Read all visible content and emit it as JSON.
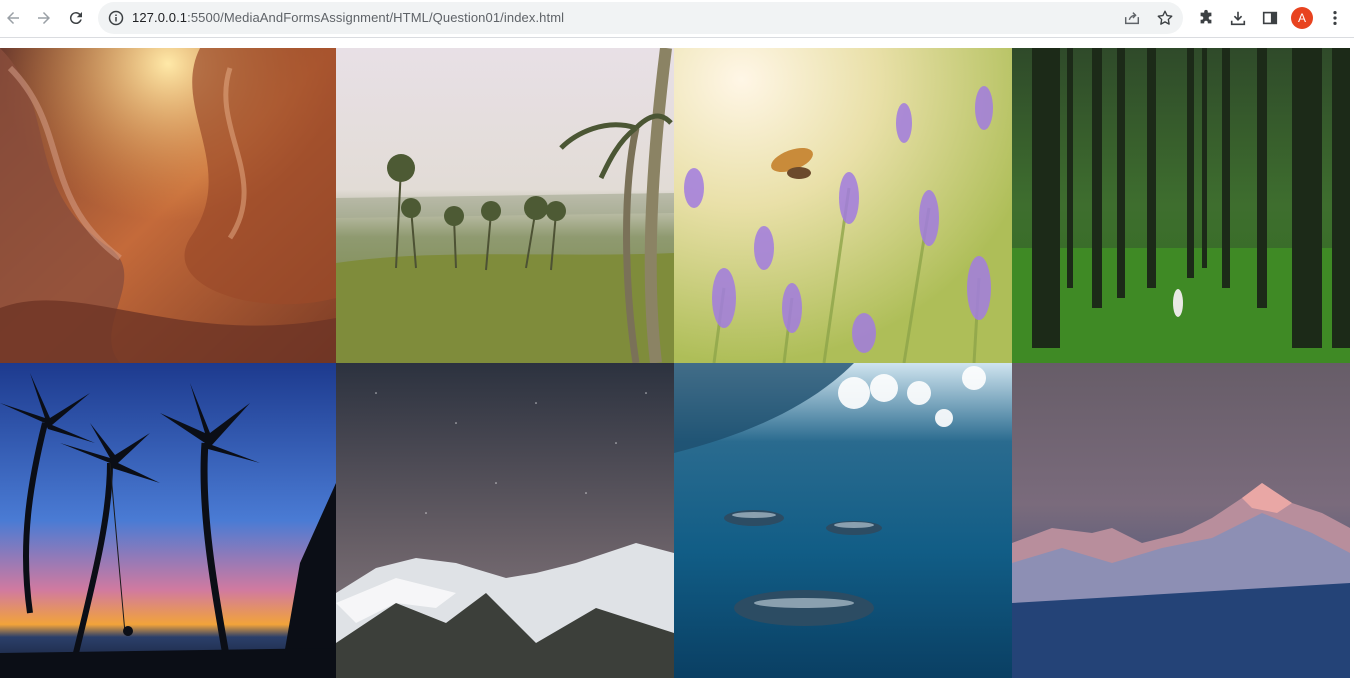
{
  "browser": {
    "url_host": "127.0.0.1",
    "url_path": ":5500/MediaAndFormsAssignment/HTML/Question01/index.html",
    "avatar_letter": "A",
    "icons": [
      "back-arrow-icon",
      "forward-arrow-icon",
      "reload-icon",
      "info-icon",
      "share-icon",
      "star-icon",
      "extensions-icon",
      "download-icon",
      "side-panel-icon",
      "kebab-menu-icon"
    ]
  },
  "gallery": {
    "images": [
      {
        "name": "canyon-image",
        "subject": "antelope canyon rock waves"
      },
      {
        "name": "palm-meadow-image",
        "subject": "palm trees on green meadow"
      },
      {
        "name": "lavender-moth-image",
        "subject": "hummingbird moth over lavender"
      },
      {
        "name": "forest-image",
        "subject": "person in tall green forest"
      },
      {
        "name": "sunset-swing-image",
        "subject": "palm swing at sunset beach"
      },
      {
        "name": "starry-mountain-image",
        "subject": "snowy mountain under stars"
      },
      {
        "name": "dolphins-image",
        "subject": "dolphins underwater"
      },
      {
        "name": "pink-peaks-image",
        "subject": "pink alpenglow mountain peaks"
      }
    ]
  }
}
